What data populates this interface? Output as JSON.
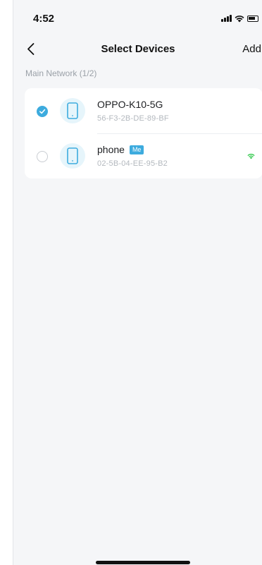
{
  "status_bar": {
    "time": "4:52"
  },
  "nav": {
    "title": "Select Devices",
    "add_label": "Add"
  },
  "section": {
    "label": "Main Network (1/2)"
  },
  "devices": [
    {
      "name": "OPPO-K10-5G",
      "mac": "56-F3-2B-DE-89-BF",
      "selected": true,
      "badge": "",
      "connection": ""
    },
    {
      "name": "phone",
      "mac": "02-5B-04-EE-95-B2",
      "selected": false,
      "badge": "Me",
      "connection": "wifi"
    }
  ],
  "colors": {
    "accent": "#3dabde",
    "wifi": "#2fc84a",
    "background": "#f5f6f8"
  }
}
